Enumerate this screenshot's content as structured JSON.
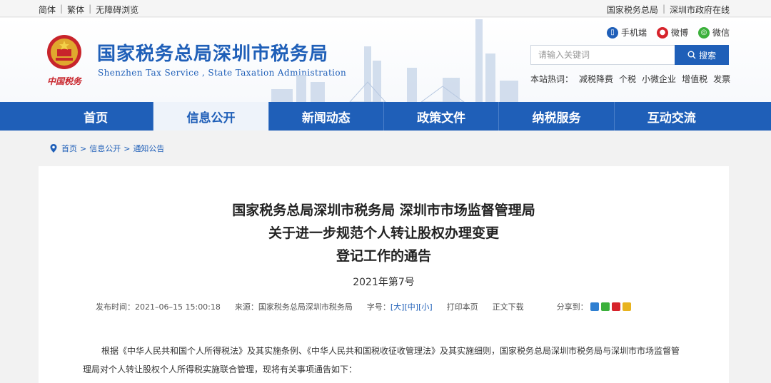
{
  "topbar": {
    "left": [
      "简体",
      "繁体",
      "无障碍浏览"
    ],
    "right": [
      "国家税务总局",
      "深圳市政府在线"
    ]
  },
  "header": {
    "title": "国家税务总局深圳市税务局",
    "subtitle": "Shenzhen Tax Service , State Taxation Administration",
    "logo_sign": "中国税务",
    "links": [
      {
        "label": "手机端",
        "icon": "mobile-icon",
        "color": "#1f5fb8"
      },
      {
        "label": "微博",
        "icon": "weibo-icon",
        "color": "#d6232b"
      },
      {
        "label": "微信",
        "icon": "wechat-icon",
        "color": "#3bb03b"
      }
    ],
    "search": {
      "placeholder": "请输入关键词",
      "button": "搜索"
    },
    "hot_label": "本站热词：",
    "hot_words": [
      "减税降费",
      "个税",
      "小微企业",
      "增值税",
      "发票"
    ]
  },
  "nav": {
    "tabs": [
      "首页",
      "信息公开",
      "新闻动态",
      "政策文件",
      "纳税服务",
      "互动交流"
    ],
    "active_index": 1
  },
  "breadcrumb": {
    "items": [
      "首页",
      "信息公开",
      "通知公告"
    ],
    "separator": ">"
  },
  "article": {
    "title_line1": "国家税务总局深圳市税务局 深圳市市场监督管理局",
    "title_line2": "关于进一步规范个人转让股权办理变更",
    "title_line3": "登记工作的通告",
    "doc_no": "2021年第7号",
    "meta": {
      "publish": "发布时间：2021–06–15 15:00:18",
      "source": "来源：国家税务总局深圳市税务局",
      "size_label": "字号：",
      "sizes": [
        "[大]",
        "[中]",
        "[小]"
      ],
      "print": "打印本页",
      "download": "正文下载",
      "share": "分享到："
    },
    "paragraph": "根据《中华人民共和国个人所得税法》及其实施条例、《中华人民共和国税收征收管理法》及其实施细则，国家税务总局深圳市税务局与深圳市市场监督管理局对个人转让股权个人所得税实施联合管理，现将有关事项通告如下："
  },
  "colors": {
    "brand": "#1f5fb8",
    "accent_red": "#c8242b"
  }
}
